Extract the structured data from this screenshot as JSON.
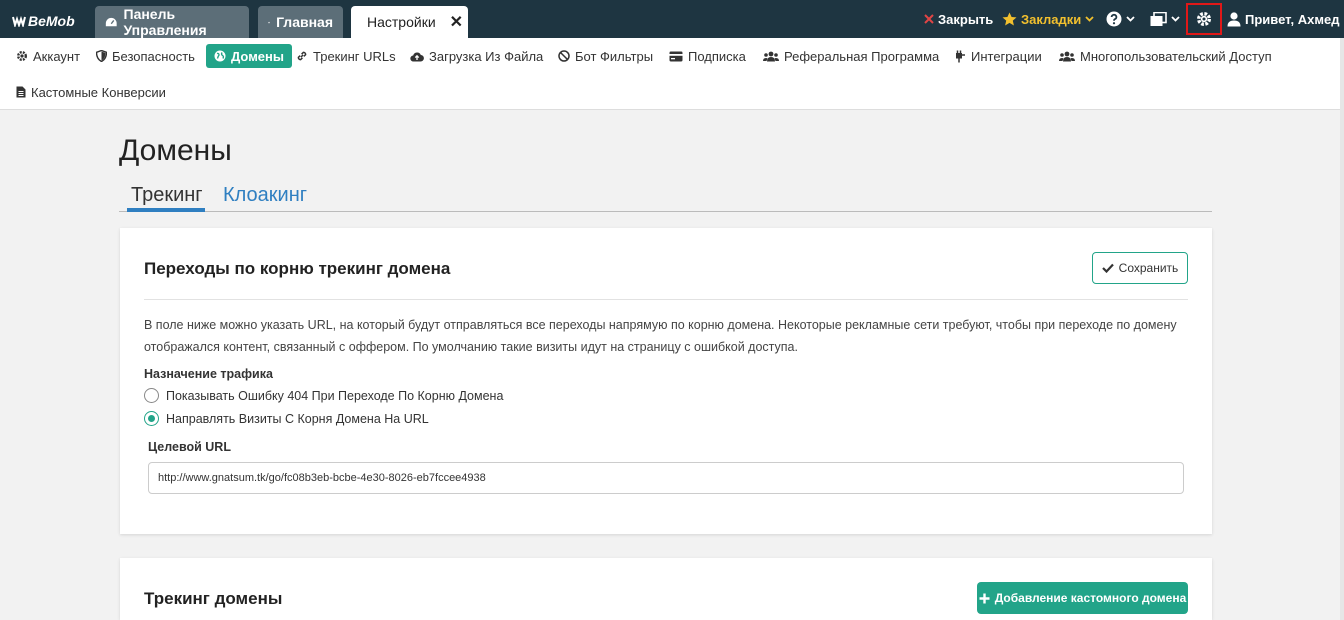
{
  "logo": {
    "text": "BeMob"
  },
  "top_tabs": [
    {
      "label": "Панель Управления"
    },
    {
      "label": "Главная"
    },
    {
      "label": "Настройки",
      "close": "✕"
    }
  ],
  "top_right": {
    "close_label": "Закрыть",
    "bookmarks_label": "Закладки",
    "greeting": "Привет, Ахмед"
  },
  "subnav": [
    {
      "label": "Аккаунт",
      "icon": "gear-icon"
    },
    {
      "label": "Безопасность",
      "icon": "shield-icon"
    },
    {
      "label": "Домены",
      "icon": "globe-icon"
    },
    {
      "label": "Трекинг URLs",
      "icon": "link-icon"
    },
    {
      "label": "Загрузка Из Файла",
      "icon": "cloud-upload-icon"
    },
    {
      "label": "Бот Фильтры",
      "icon": "ban-icon"
    },
    {
      "label": "Подписка",
      "icon": "credit-card-icon"
    },
    {
      "label": "Реферальная Программа",
      "icon": "users-icon"
    },
    {
      "label": "Интеграции",
      "icon": "plug-icon"
    },
    {
      "label": "Многопользовательский Доступ",
      "icon": "group-icon"
    },
    {
      "label": "Кастомные Конверсии",
      "icon": "file-icon"
    }
  ],
  "page": {
    "title": "Домены",
    "tabs": [
      {
        "label": "Трекинг"
      },
      {
        "label": "Клоакинг"
      }
    ]
  },
  "root_card": {
    "title": "Переходы по корню трекинг домена",
    "save_label": "Сохранить",
    "description": "В поле ниже можно указать URL, на который будут отправляться все переходы напрямую по корню домена. Некоторые рекламные сети требуют, чтобы при переходе по домену отображался контент, связанный с оффером. По умолчанию такие визиты идут на страницу с ошибкой доступа.",
    "traffic_label": "Назначение трафика",
    "options": [
      {
        "label": "Показывать Ошибку 404 При Переходе По Корню Домена",
        "selected": false
      },
      {
        "label": "Направлять Визиты С Корня Домена На URL",
        "selected": true
      }
    ],
    "target_url_label": "Целевой URL",
    "target_url_value": "http://www.gnatsum.tk/go/fc08b3eb-bcbe-4e30-8026-eb7fccee4938"
  },
  "domains_card": {
    "title": "Трекинг домены",
    "add_label": "Добавление кастомного домена"
  },
  "colors": {
    "accent": "#22a489",
    "topbar": "#1e3541",
    "link": "#2f7fc1",
    "bookmark": "#f2c02e",
    "close_x": "#e04545",
    "highlight": "#e01818"
  }
}
